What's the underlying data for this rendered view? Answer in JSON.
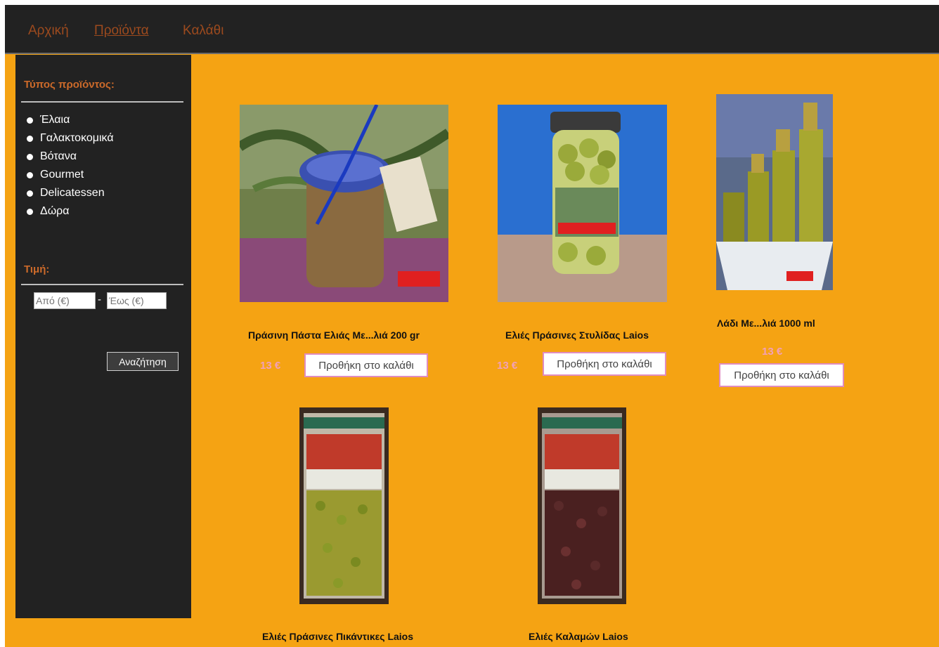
{
  "nav": {
    "items": [
      {
        "label": "Αρχική"
      },
      {
        "label": "Προϊόντα"
      },
      {
        "label": "Καλάθι"
      }
    ]
  },
  "sidebar": {
    "type_heading": "Τύπος προϊόντος:",
    "categories": [
      "Έλαια",
      "Γαλακτοκομικά",
      "Βότανα",
      "Gourmet",
      "Delicatessen",
      "Δώρα"
    ],
    "price_heading": "Τιμή:",
    "price_from_placeholder": "Από (€)",
    "price_to_placeholder": "Έως (€)",
    "search_label": "Αναζήτηση"
  },
  "products": [
    {
      "title": "Πράσινη Πάστα Ελιάς Με...λιά 200 gr",
      "price": "13 €",
      "cart_label": "Προθήκη στο καλάθι"
    },
    {
      "title": "Ελιές Πράσινες Στυλίδας Laios",
      "price": "13 €",
      "cart_label": "Προθήκη στο καλάθι"
    },
    {
      "title": "Λάδι Με...λιά 1000 ml",
      "price": "13 €",
      "cart_label": "Προθήκη στο καλάθι"
    },
    {
      "title": "Ελιές Πράσινες Πικάντικες Laios"
    },
    {
      "title": "Ελιές Καλαμών Laios"
    }
  ],
  "colors": {
    "background": "#f5a313",
    "topbar": "#222222",
    "sidebar": "#222222",
    "nav_link": "#9c4a1e",
    "sidebar_heading": "#cc6a2a",
    "price": "#f2a0b8",
    "cart_button_border": "#e08cc0"
  }
}
